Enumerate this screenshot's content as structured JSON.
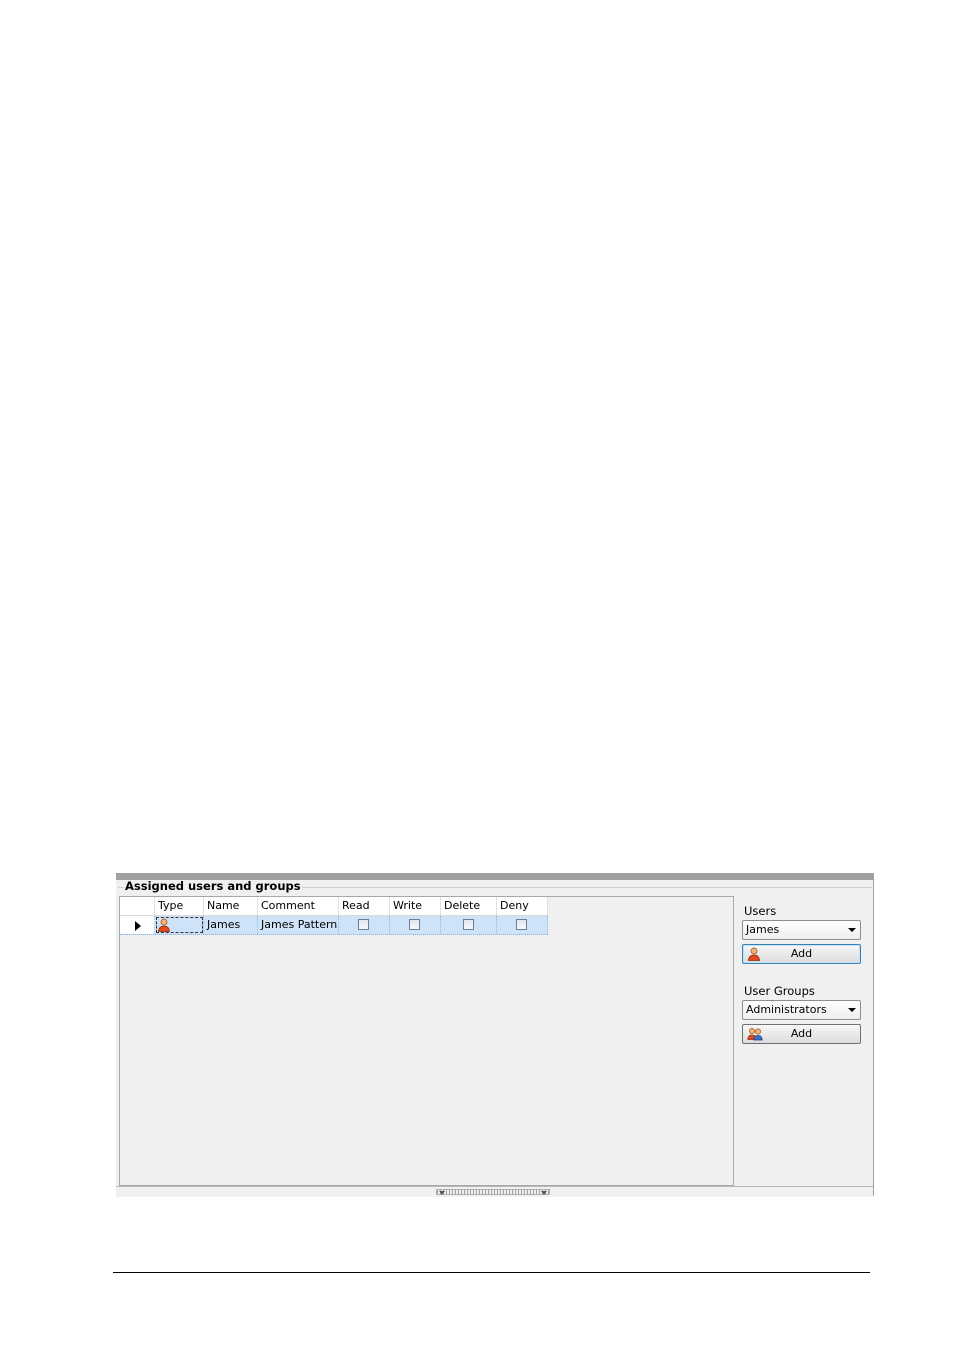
{
  "panel": {
    "title": "Assigned users and groups"
  },
  "grid": {
    "columns": [
      "Type",
      "Name",
      "Comment",
      "Read",
      "Write",
      "Delete",
      "Deny"
    ],
    "rows": [
      {
        "type_icon": "user-icon",
        "name": "James",
        "comment": "James Pattern",
        "read": false,
        "write": false,
        "delete": false,
        "deny": false,
        "selected": true
      }
    ]
  },
  "users": {
    "label": "Users",
    "selected": "James",
    "add_label": "Add",
    "add_icon": "user-icon"
  },
  "user_groups": {
    "label": "User Groups",
    "selected": "Administrators",
    "add_label": "Add",
    "add_icon": "user-group-icon"
  },
  "colors": {
    "selection": "#cfe3f8",
    "panel_bg": "#f0f0f0",
    "top_bar": "#a0a0a0"
  }
}
